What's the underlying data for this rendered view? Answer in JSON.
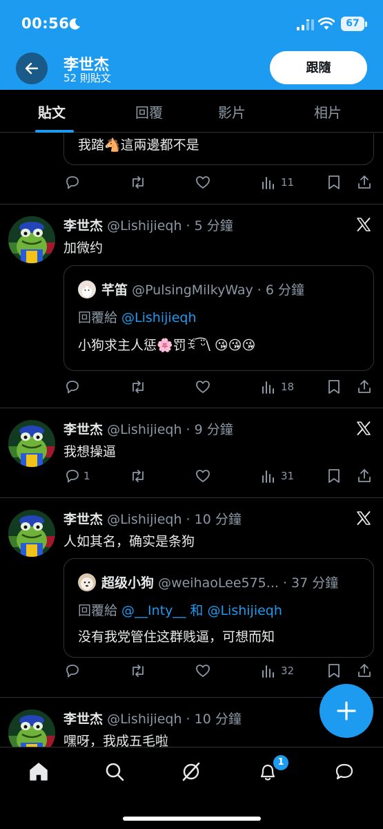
{
  "status_bar": {
    "time": "00:56",
    "battery": "67"
  },
  "header": {
    "name": "李世杰",
    "post_count": "52 則貼文",
    "follow_label": "跟隨"
  },
  "tabs": [
    {
      "label": "貼文"
    },
    {
      "label": "回覆"
    },
    {
      "label": "影片"
    },
    {
      "label": "相片"
    }
  ],
  "posts": [
    {
      "quote_tail_text": "我踏🐴這兩邊都不是",
      "views": "11"
    },
    {
      "name": "李世杰",
      "handle_time": "@Lishijieqh · 5 分鐘",
      "text": "加微约",
      "quote": {
        "name": "芊笛",
        "handle_time": "@PulsingMilkyWay · 6 分鐘",
        "reply_prefix": "回覆給 ",
        "reply_to": "@Lishijieqh",
        "text": "小狗求主人惩🌸罚ꉂ ͡ᵕ̈\\ 😘😘😘"
      },
      "views": "18"
    },
    {
      "name": "李世杰",
      "handle_time": "@Lishijieqh · 9 分鐘",
      "text": "我想操逼",
      "replies": "1",
      "views": "31"
    },
    {
      "name": "李世杰",
      "handle_time": "@Lishijieqh · 10 分鐘",
      "text": "人如其名，确实是条狗",
      "quote": {
        "name": "超级小狗",
        "handle_time": "@weihaoLee575... · 37 分鐘",
        "reply_prefix": "回覆給 ",
        "reply_to": "@__Inty__ 和 @Lishijieqh",
        "text": "没有我党管住这群贱逼，可想而知"
      },
      "views": "32"
    },
    {
      "name": "李世杰",
      "handle_time": "@Lishijieqh · 10 分鐘",
      "text": "嘿呀，我成五毛啦"
    }
  ],
  "nav": {
    "notification_badge": "1"
  },
  "colors": {
    "accent": "#1d9bf0",
    "background": "#000000",
    "muted": "#8b98a5",
    "divider": "#2f3336"
  },
  "icons": [
    "back-arrow-icon",
    "x-logo-icon",
    "reply-icon",
    "repost-icon",
    "like-icon",
    "views-icon",
    "bookmark-icon",
    "share-icon",
    "compose-icon",
    "home-icon",
    "search-icon",
    "grok-icon",
    "notifications-icon",
    "messages-icon"
  ]
}
